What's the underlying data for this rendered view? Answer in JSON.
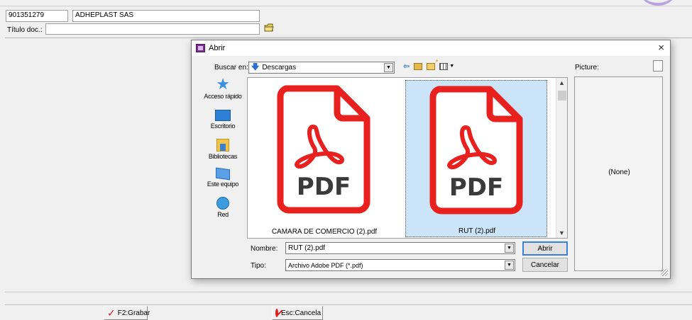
{
  "form": {
    "code": "901351279",
    "company": "ADHEPLAST SAS",
    "titulo_label": "Título doc.:",
    "titulo_value": "",
    "grabar_label": "F2:Grabar",
    "cancela_label": "Esc:Cancela"
  },
  "dialog": {
    "title": "Abrir",
    "close": "×",
    "buscar_label": "Buscar en:",
    "buscar_value": "Descargas",
    "picture_label": "Picture:",
    "picture_none": "(None)",
    "places": [
      {
        "label": "Acceso rápido",
        "icon": "quick-access-icon"
      },
      {
        "label": "Escritorio",
        "icon": "desktop-icon"
      },
      {
        "label": "Bibliotecas",
        "icon": "libraries-icon"
      },
      {
        "label": "Este equipo",
        "icon": "this-pc-icon"
      },
      {
        "label": "Red",
        "icon": "network-icon"
      }
    ],
    "files": [
      {
        "name": "CAMARA DE COMERCIO (2).pdf",
        "badge": "PDF",
        "selected": false
      },
      {
        "name": "RUT (2).pdf",
        "badge": "PDF",
        "selected": true
      }
    ],
    "nombre_label": "Nombre:",
    "nombre_value": "RUT (2).pdf",
    "tipo_label": "Tipo:",
    "tipo_value": "Archivo Adobe PDF (*.pdf)",
    "abrir_label": "Abrir",
    "cancelar_label": "Cancelar",
    "colors": {
      "pdf_red": "#e8211f",
      "selection": "#cce4f7"
    }
  }
}
